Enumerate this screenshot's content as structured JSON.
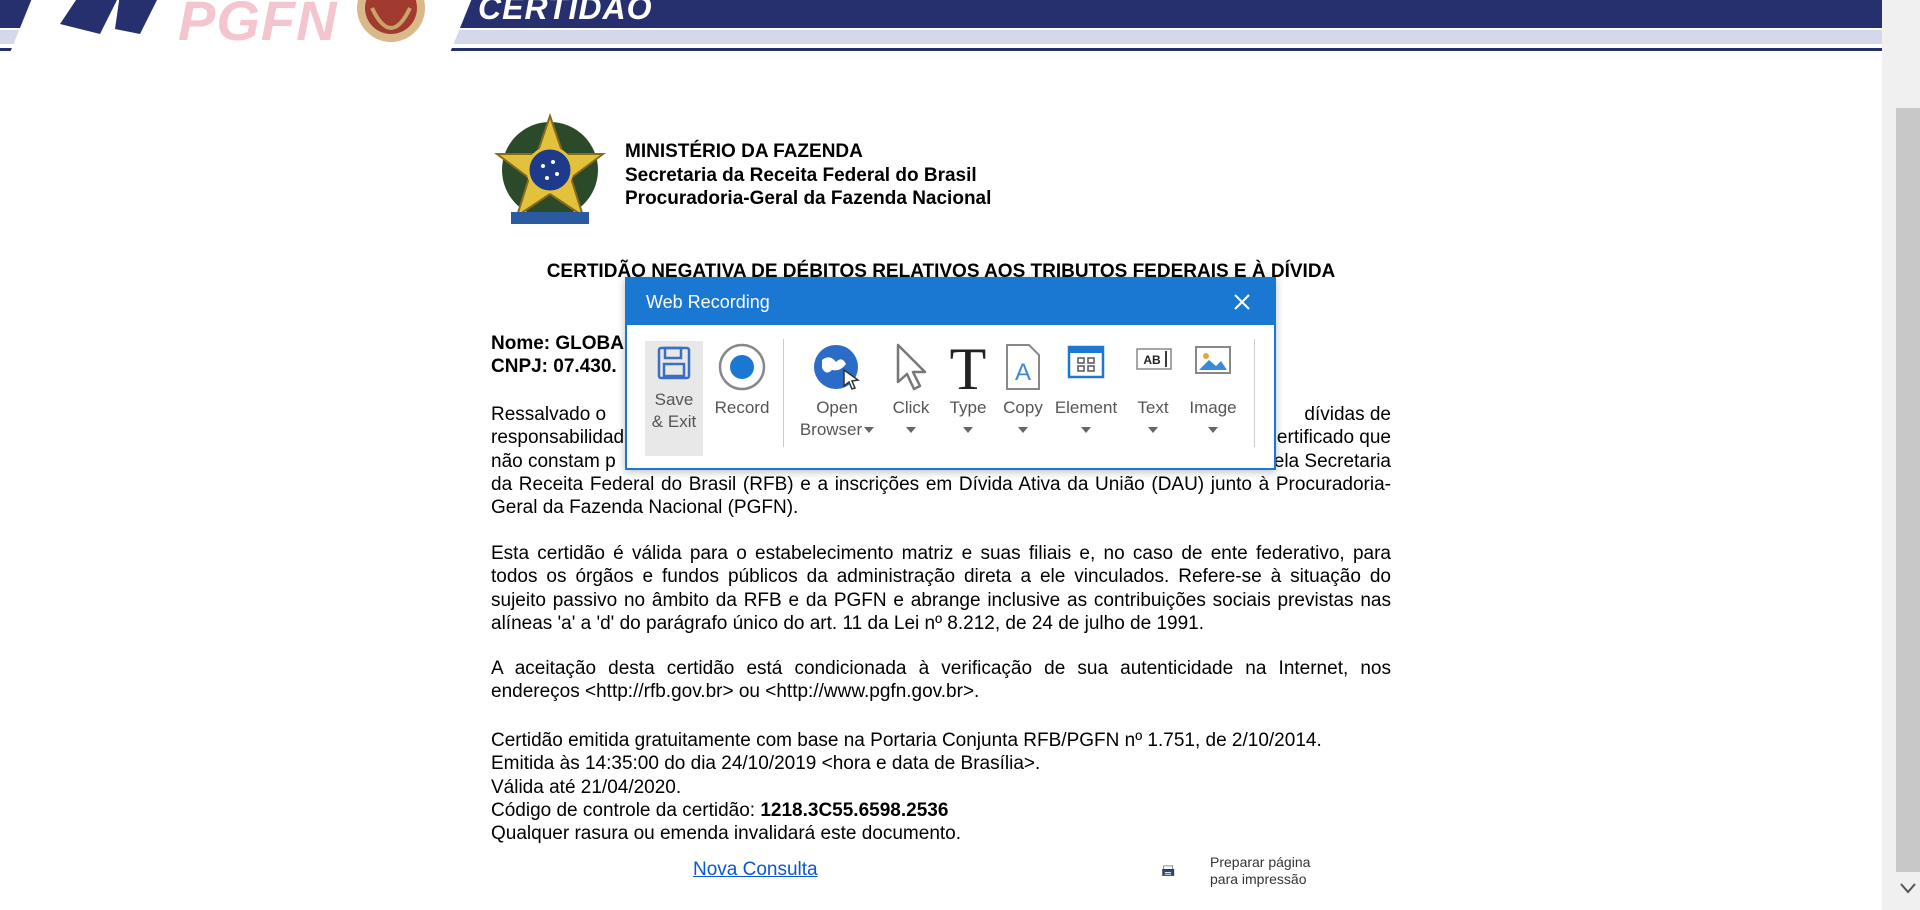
{
  "banner": {
    "brand": "PGFN",
    "title": "CERTIDÃO"
  },
  "header": {
    "ministry_line1": "MINISTÉRIO DA FAZENDA",
    "ministry_line2": "Secretaria da Receita Federal do Brasil",
    "ministry_line3": "Procuradoria-Geral da Fazenda Nacional"
  },
  "certificate": {
    "title": "CERTIDÃO NEGATIVA DE DÉBITOS RELATIVOS AOS TRIBUTOS FEDERAIS E À DÍVIDA",
    "name_label": "Nome: GLOBA",
    "cnpj_label": "CNPJ: 07.430.",
    "par1_left_line1": "Ressalvado o",
    "par1_right_line1": "dívidas de",
    "par1_left_line2": "responsabilidad",
    "par1_right_line2": "ertificado que",
    "par1_left_line3": "não constam p",
    "par1_right_line3": "ela Secretaria",
    "par1_rest": "da Receita Federal do Brasil (RFB) e a inscrições em Dívida Ativa da União (DAU) junto à Procuradoria-Geral da Fazenda Nacional (PGFN).",
    "par2": "Esta certidão é válida para o estabelecimento matriz e suas filiais e, no caso de ente federativo, para todos os órgãos e fundos públicos da administração direta a ele vinculados. Refere-se à situação do sujeito passivo no âmbito da RFB e da PGFN e abrange inclusive as contribuições sociais previstas nas alíneas 'a' a 'd' do parágrafo único do art. 11 da Lei nº 8.212, de 24 de julho de 1991.",
    "par3": "A aceitação desta certidão está condicionada à verificação de sua autenticidade na Internet, nos endereços <http://rfb.gov.br> ou <http://www.pgfn.gov.br>.",
    "line_issued_basis": "Certidão emitida gratuitamente com base na Portaria Conjunta RFB/PGFN nº 1.751, de 2/10/2014.",
    "line_issued_at": "Emitida às 14:35:00 do dia 24/10/2019 <hora e data de Brasília>.",
    "line_valid_until": "Válida até 21/04/2020.",
    "control_label": "Código de controle da certidão: ",
    "control_code": "1218.3C55.6598.2536",
    "line_warning": "Qualquer rasura ou emenda invalidará este documento."
  },
  "links": {
    "new_query": "Nova Consulta",
    "print_line1": "Preparar página",
    "print_line2": "para impressão"
  },
  "dialog": {
    "title": "Web Recording",
    "tools": [
      {
        "line1": "Save",
        "line2": "& Exit",
        "icon": "floppy-disk-icon"
      },
      {
        "line1": "Record",
        "line2": "",
        "icon": "record-icon"
      },
      {
        "line1": "Open",
        "line2": "Browser",
        "icon": "globe-cursor-icon"
      },
      {
        "line1": "Click",
        "line2": "",
        "icon": "pointer-icon"
      },
      {
        "line1": "Type",
        "line2": "",
        "icon": "type-T-icon"
      },
      {
        "line1": "Copy",
        "line2": "",
        "icon": "document-A-icon"
      },
      {
        "line1": "Element",
        "line2": "",
        "icon": "grid-window-icon"
      },
      {
        "line1": "Text",
        "line2": "",
        "icon": "text-cursor-icon"
      },
      {
        "line1": "Image",
        "line2": "",
        "icon": "picture-icon"
      }
    ],
    "accent_color": "#1a78d2"
  }
}
